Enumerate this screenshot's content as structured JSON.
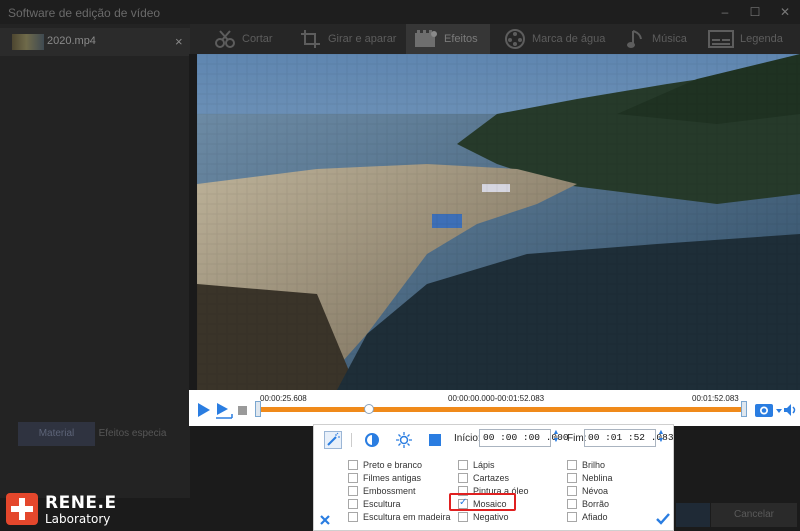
{
  "window": {
    "title": "Software de edição de vídeo",
    "minimize": "–",
    "maximize": "☐",
    "close": "✕"
  },
  "sidebar": {
    "file_name": "2020.mp4",
    "file_close": "×",
    "tab_material": "Material",
    "tab_effects": "Efeitos especia"
  },
  "toolbar": [
    {
      "label": "Cortar",
      "icon": "cut-icon"
    },
    {
      "label": "Girar e aparar",
      "icon": "crop-icon"
    },
    {
      "label": "Efeitos",
      "icon": "effects-icon",
      "active": true
    },
    {
      "label": "Marca de água",
      "icon": "watermark-icon"
    },
    {
      "label": "Música",
      "icon": "music-icon"
    },
    {
      "label": "Legenda",
      "icon": "subtitle-icon"
    }
  ],
  "timeline": {
    "current_time": "00:00:25.608",
    "range": "00:00:00.000-00:01:52.083",
    "end_time": "00:01:52.083",
    "progress": 0.228
  },
  "effects_panel": {
    "start_label": "Início:",
    "start_value": "00 :00 :00 .000",
    "end_label": "Fim:",
    "end_value": "00 :01 :52 .083",
    "columns": [
      [
        {
          "label": "Preto e branco",
          "checked": false
        },
        {
          "label": "Filmes antigas",
          "checked": false
        },
        {
          "label": "Embossment",
          "checked": false
        },
        {
          "label": "Escultura",
          "checked": false
        },
        {
          "label": "Escultura em madeira",
          "checked": false
        }
      ],
      [
        {
          "label": "Lápis",
          "checked": false
        },
        {
          "label": "Cartazes",
          "checked": false
        },
        {
          "label": "Pintura a óleo",
          "checked": false
        },
        {
          "label": "Mosaico",
          "checked": true
        },
        {
          "label": "Negativo",
          "checked": false
        }
      ],
      [
        {
          "label": "Brilho",
          "checked": false
        },
        {
          "label": "Neblina",
          "checked": false
        },
        {
          "label": "Névoa",
          "checked": false
        },
        {
          "label": "Borrão",
          "checked": false
        },
        {
          "label": "Afiado",
          "checked": false
        }
      ]
    ]
  },
  "footer": {
    "brand_name": "RENE.E",
    "brand_sub": "Laboratory",
    "cancel_label": "Cancelar"
  },
  "colors": {
    "accent": "#2a7de1",
    "timeline": "#f08a1a",
    "highlight": "#e02020"
  }
}
